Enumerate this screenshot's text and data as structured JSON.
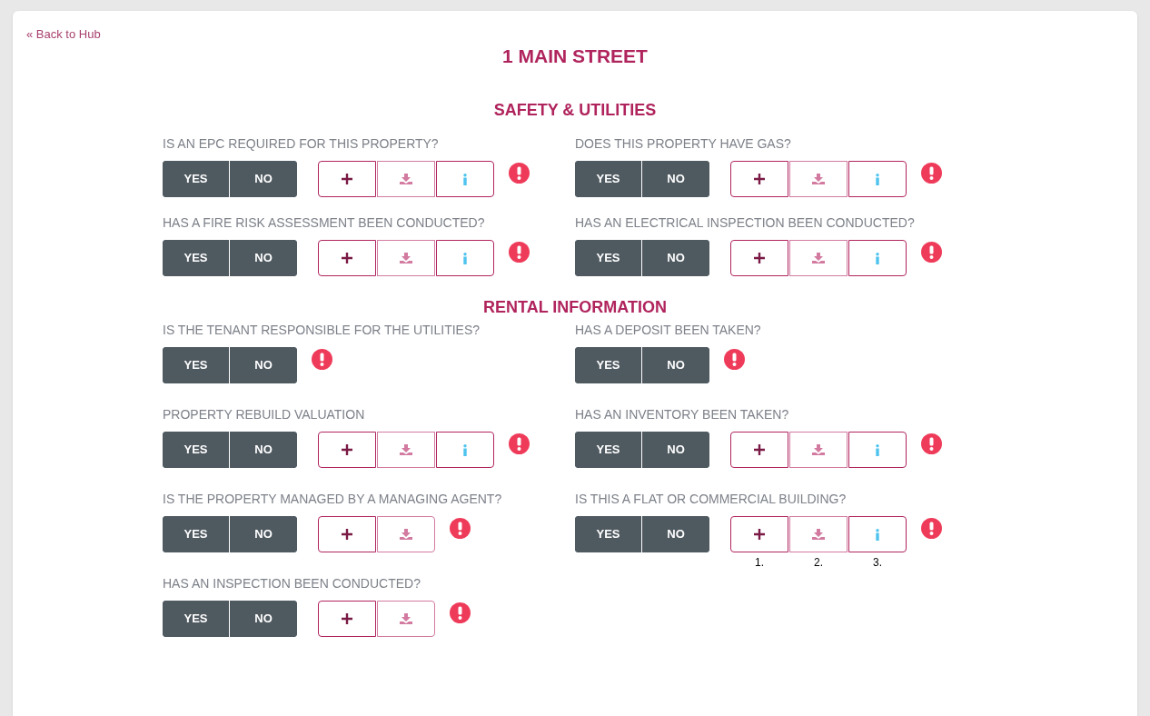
{
  "back_link": "« Back to Hub",
  "title": "1 MAIN STREET",
  "sections": [
    {
      "heading": "SAFETY & UTILITIES",
      "questions": [
        {
          "label": "IS AN EPC REQUIRED FOR THIS PROPERTY?",
          "yes": "YES",
          "no": "NO",
          "tools": [
            {
              "kind": "add"
            },
            {
              "kind": "download"
            },
            {
              "kind": "info"
            }
          ]
        },
        {
          "label": "DOES THIS PROPERTY HAVE GAS?",
          "yes": "YES",
          "no": "NO",
          "tools": [
            {
              "kind": "add"
            },
            {
              "kind": "download"
            },
            {
              "kind": "info"
            }
          ]
        },
        {
          "label": "HAS A FIRE RISK ASSESSMENT BEEN CONDUCTED?",
          "yes": "YES",
          "no": "NO",
          "tools": [
            {
              "kind": "add"
            },
            {
              "kind": "download"
            },
            {
              "kind": "info"
            }
          ]
        },
        {
          "label": "HAS AN ELECTRICAL INSPECTION BEEN CONDUCTED?",
          "yes": "YES",
          "no": "NO",
          "tools": [
            {
              "kind": "add"
            },
            {
              "kind": "download"
            },
            {
              "kind": "info"
            }
          ]
        }
      ]
    },
    {
      "heading": "RENTAL INFORMATION",
      "questions": [
        {
          "label": "IS THE TENANT RESPONSIBLE FOR THE UTILITIES?",
          "yes": "YES",
          "no": "NO"
        },
        {
          "label": "HAS A DEPOSIT BEEN TAKEN?",
          "yes": "YES",
          "no": "NO"
        },
        {
          "label": "PROPERTY REBUILD VALUATION",
          "yes": "YES",
          "no": "NO",
          "tools": [
            {
              "kind": "add"
            },
            {
              "kind": "download"
            },
            {
              "kind": "info"
            }
          ]
        },
        {
          "label": "HAS AN INVENTORY BEEN TAKEN?",
          "yes": "YES",
          "no": "NO",
          "tools": [
            {
              "kind": "add"
            },
            {
              "kind": "download"
            },
            {
              "kind": "info"
            }
          ]
        },
        {
          "label": "IS THE PROPERTY MANAGED BY A MANAGING AGENT?",
          "yes": "YES",
          "no": "NO",
          "tools": [
            {
              "kind": "add"
            },
            {
              "kind": "download"
            }
          ]
        },
        {
          "label": "IS THIS A FLAT OR COMMERCIAL BUILDING?",
          "yes": "YES",
          "no": "NO",
          "tools": [
            {
              "kind": "add",
              "number": "1."
            },
            {
              "kind": "download",
              "number": "2."
            },
            {
              "kind": "info",
              "number": "3."
            }
          ]
        },
        {
          "label": "HAS AN INSPECTION BEEN CONDUCTED?",
          "yes": "YES",
          "no": "NO",
          "tools": [
            {
              "kind": "add"
            },
            {
              "kind": "download"
            }
          ]
        }
      ]
    }
  ]
}
